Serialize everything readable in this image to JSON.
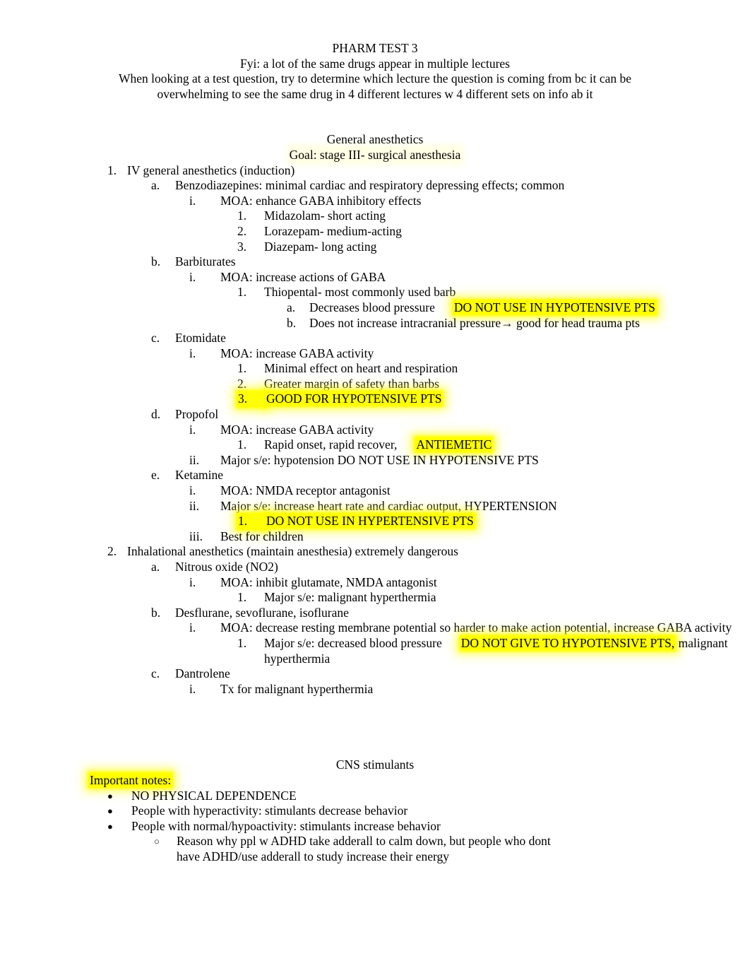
{
  "document": {
    "title": "PHARM TEST 3",
    "header_lines": [
      "PHARM TEST 3",
      "Fyi: a lot of the same drugs appear in multiple lectures",
      "When looking at a test question, try to determine which lecture the question is coming from bc it can be overwhelming to see the same drug in 4 different lectures w 4 different sets on info ab it"
    ]
  },
  "section_general": {
    "heading": "General anesthetics",
    "goal": "Goal: stage III- surgical anesthesia",
    "item1": {
      "marker": "1.",
      "text": "IV general anesthetics (induction)",
      "a": {
        "marker": "a.",
        "text": "Benzodiazepines: minimal cardiac and respiratory depressing effects; common",
        "i": {
          "marker": "i.",
          "text": "MOA: enhance GABA inhibitory effects",
          "items": [
            {
              "marker": "1.",
              "text": "Midazolam- short acting"
            },
            {
              "marker": "2.",
              "text": "Lorazepam- medium-acting"
            },
            {
              "marker": "3.",
              "text": "Diazepam- long acting"
            }
          ]
        }
      },
      "b": {
        "marker": "b.",
        "text": "Barbiturates",
        "i": {
          "marker": "i.",
          "text": "MOA: increase actions of GABA",
          "one": {
            "marker": "1.",
            "text": "Thiopental- most commonly used barb",
            "a": {
              "marker": "a.",
              "text_plain": "Decreases blood pressure",
              "text_highlight": "DO NOT USE IN HYPOTENSIVE PTS"
            },
            "b": {
              "marker": "b.",
              "text": "Does not increase intracranial pressure→ good for head trauma pts"
            }
          }
        }
      },
      "c": {
        "marker": "c.",
        "text": "Etomidate",
        "i": {
          "marker": "i.",
          "text": "MOA: increase GABA activity",
          "items": [
            {
              "marker": "1.",
              "text": "Minimal effect on heart and respiration",
              "highlight": false
            },
            {
              "marker": "2.",
              "text": "Greater margin of safety than barbs",
              "highlight": false
            },
            {
              "marker": "3.",
              "text": "GOOD FOR HYPOTENSIVE PTS",
              "highlight": true
            }
          ]
        }
      },
      "d": {
        "marker": "d.",
        "text": "Propofol",
        "i": {
          "marker": "i.",
          "text": "MOA: increase GABA activity",
          "one": {
            "marker": "1.",
            "text_plain": "Rapid onset, rapid recover,",
            "text_highlight": "ANTIEMETIC"
          }
        },
        "ii": {
          "marker": "ii.",
          "text": "Major s/e: hypotension DO NOT USE IN HYPOTENSIVE PTS"
        }
      },
      "e": {
        "marker": "e.",
        "text": "Ketamine",
        "i": {
          "marker": "i.",
          "text": "MOA: NMDA receptor antagonist"
        },
        "ii": {
          "marker": "ii.",
          "text": "Major s/e: increase heart rate and cardiac output, HYPERTENSION",
          "one": {
            "marker": "1.",
            "text": "DO NOT USE IN HYPERTENSIVE PTS",
            "highlight": true
          }
        },
        "iii": {
          "marker": "iii.",
          "text": "Best for children"
        }
      }
    },
    "item2": {
      "marker": "2.",
      "text": "Inhalational anesthetics (maintain anesthesia) extremely dangerous",
      "a": {
        "marker": "a.",
        "text": "Nitrous oxide (NO2)",
        "i": {
          "marker": "i.",
          "text": "MOA: inhibit glutamate, NMDA antagonist",
          "one": {
            "marker": "1.",
            "text": "Major s/e: malignant hyperthermia"
          }
        }
      },
      "b": {
        "marker": "b.",
        "text": "Desflurane, sevoflurane, isoflurane",
        "i": {
          "marker": "i.",
          "text": "MOA: decrease resting membrane potential so harder to make action potential, increase GABA activity",
          "one": {
            "marker": "1.",
            "text_plain": "Major s/e: decreased blood pressure",
            "text_highlight": "DO NOT GIVE TO HYPOTENSIVE PTS,",
            "text_tail": " malignant hyperthermia"
          }
        }
      },
      "c": {
        "marker": "c.",
        "text": "Dantrolene",
        "i": {
          "marker": "i.",
          "text": "Tx for malignant hyperthermia"
        }
      }
    }
  },
  "section_cns": {
    "heading": "CNS stimulants",
    "important_notes_label": "Important notes:",
    "bullets": [
      {
        "marker": "●",
        "text": "NO PHYSICAL DEPENDENCE"
      },
      {
        "marker": "●",
        "text": "People with hyperactivity: stimulants decrease behavior"
      },
      {
        "marker": "●",
        "text": "People with normal/hypoactivity: stimulants increase behavior"
      }
    ],
    "sub_bullet": {
      "marker": "○",
      "text": "Reason why ppl w ADHD take adderall to calm down, but people who dont have ADHD/use adderall to study increase their energy"
    }
  },
  "colors": {
    "highlight": "#ffff00",
    "text": "#000000",
    "page": "#ffffff"
  }
}
